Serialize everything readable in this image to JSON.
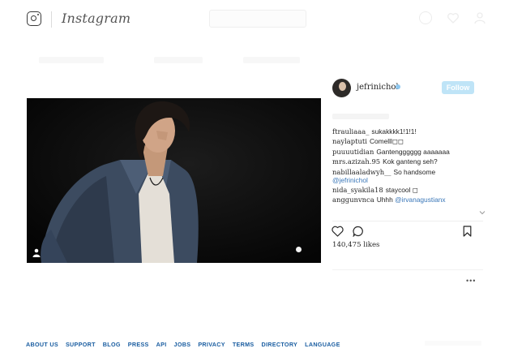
{
  "header": {
    "brand": "Instagram",
    "icons": [
      "instagram-glyph-icon",
      "compass-icon",
      "heart-icon",
      "user-icon"
    ]
  },
  "post": {
    "image_icons": [
      "user-tag-icon",
      "dot-icon"
    ],
    "author": {
      "username": "jefrinichol",
      "verified": true,
      "follow_label": "Follow"
    },
    "comments": [
      {
        "user": "ftrauliaaa_",
        "text": "sukakkkk1!1!1!"
      },
      {
        "user": "naylaptuti",
        "text": "Comelll◻◻"
      },
      {
        "user": "puuuutidian",
        "text": "Gantengggggg aaaaaaa"
      },
      {
        "user": "mrs.azizah.95",
        "text": "Kok ganteng seh?"
      },
      {
        "user": "nabillaaladwyh__",
        "text": "So handsome",
        "mention": "@jefrinichol"
      },
      {
        "user": "nida_syakila18",
        "text": "staycool ◻"
      },
      {
        "user": "anggunvnca",
        "text": "Uhhh",
        "mention": "@irvanagustianx"
      }
    ],
    "actions": [
      "heart-icon",
      "comment-icon",
      "bookmark-icon"
    ],
    "likes": "140,475 likes",
    "more_label": "•••"
  },
  "footer": {
    "links": [
      "ABOUT US",
      "SUPPORT",
      "BLOG",
      "PRESS",
      "API",
      "JOBS",
      "PRIVACY",
      "TERMS",
      "DIRECTORY",
      "LANGUAGE"
    ]
  },
  "colors": {
    "link": "#1b5ea1",
    "follow_button": "#bfe4f7",
    "mention": "#3a77b8"
  }
}
